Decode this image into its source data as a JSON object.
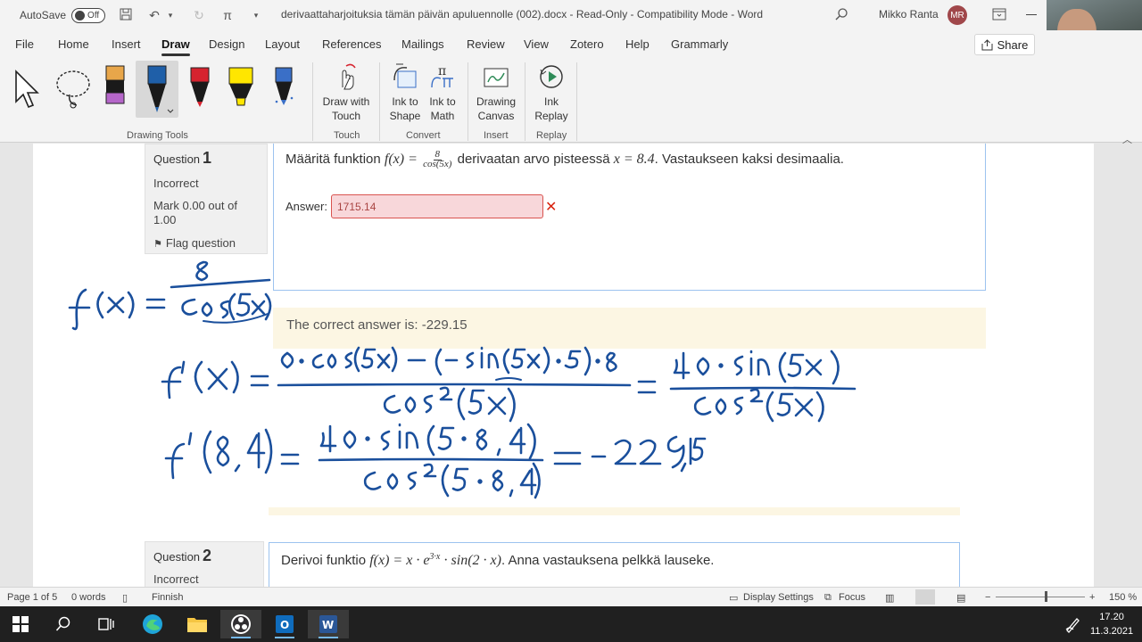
{
  "titlebar": {
    "autosave_label": "AutoSave",
    "autosave_state": "Off",
    "document_title": "derivaattaharjoituksia tämän päivän apuluennolle (002).docx - Read-Only - Compatibility Mode - Word",
    "user_name": "Mikko Ranta",
    "user_initials": "MR"
  },
  "menu": {
    "tabs": [
      "File",
      "Home",
      "Insert",
      "Draw",
      "Design",
      "Layout",
      "References",
      "Mailings",
      "Review",
      "View",
      "Zotero",
      "Help",
      "Grammarly"
    ],
    "active_tab": "Draw",
    "share_label": "Share"
  },
  "ribbon": {
    "groups": {
      "drawing_tools": "Drawing Tools",
      "touch": "Touch",
      "convert": "Convert",
      "insert": "Insert",
      "replay": "Replay"
    },
    "buttons": {
      "draw_with_touch_1": "Draw with",
      "draw_with_touch_2": "Touch",
      "ink_to_shape_1": "Ink to",
      "ink_to_shape_2": "Shape",
      "ink_to_math_1": "Ink to",
      "ink_to_math_2": "Math",
      "drawing_canvas_1": "Drawing",
      "drawing_canvas_2": "Canvas",
      "ink_replay_1": "Ink",
      "ink_replay_2": "Replay"
    },
    "pen_colors": [
      "#1a1a1a",
      "#1f5fa8",
      "#d6232f",
      "#ffe600",
      "#3a6fc7"
    ],
    "highlighter_accent": "#b566c9"
  },
  "question1": {
    "label": "Question",
    "number": "1",
    "status": "Incorrect",
    "mark_1": "Mark 0.00 out of",
    "mark_2": "1.00",
    "flag": "Flag question",
    "text_before": "Määritä funktion",
    "math_fx": "f(x) =",
    "frac_num": "8",
    "frac_den": "cos(5x)",
    "text_mid": "derivaatan arvo pisteessä",
    "math_point": "x = 8.4",
    "text_after": ". Vastaukseen kaksi desimaalia.",
    "answer_label": "Answer:",
    "answer_value": "1715.14",
    "feedback": "The correct answer is: -229.15"
  },
  "question2": {
    "label": "Question",
    "number": "2",
    "status": "Incorrect",
    "text_before": "Derivoi funktio",
    "math_expr": "f(x) = x · e",
    "math_exp": "3·x",
    "math_rest": "· sin(2 · x)",
    "text_after": ". Anna vastauksena pelkkä lauseke."
  },
  "handwriting": {
    "line1": "f(x) = 8 / cos(5x)",
    "line2": "f'(x) = (0·cos(5x) − (−sin(5x)·5)·8) / cos²(5x) = 40·sin(5x) / cos²(5x)",
    "line3": "f'(8,4) = 40·sin(5·8,4) / cos²(5·8,4) = −229,15"
  },
  "statusbar": {
    "page": "Page 1 of 5",
    "words": "0 words",
    "language": "Finnish",
    "display_settings": "Display Settings",
    "focus": "Focus",
    "zoom": "150 %"
  },
  "taskbar": {
    "time": "17.20",
    "date": "11.3.2021"
  },
  "colors": {
    "ink": "#1a4f9c",
    "error_red": "#d9230f",
    "feedback_bg": "#fcf6e3",
    "question_border": "#9cc3ef"
  }
}
